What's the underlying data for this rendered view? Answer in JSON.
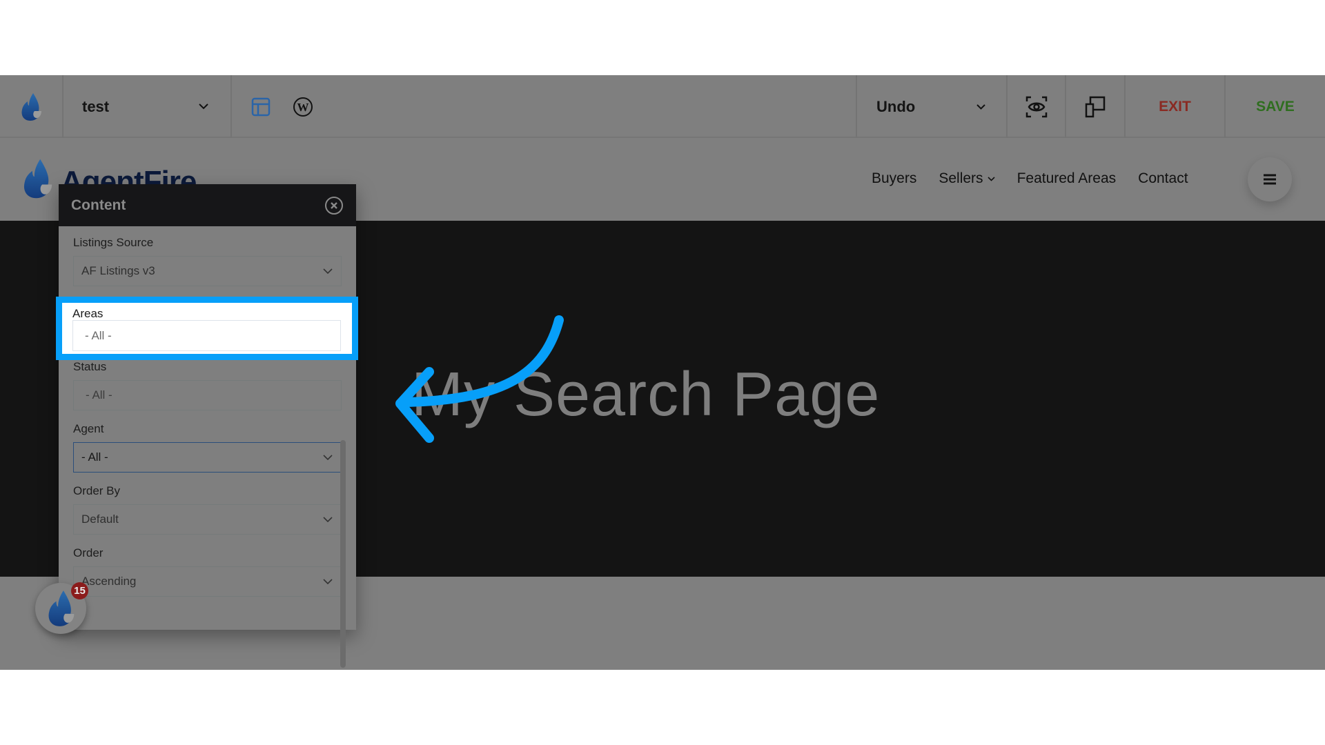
{
  "toolbar": {
    "page_selector": "test",
    "undo_label": "Undo",
    "exit_label": "EXIT",
    "save_label": "SAVE",
    "icons": {
      "logo": "flame-logo-icon",
      "layout": "layout-icon",
      "wordpress": "wordpress-icon",
      "preview": "eye-preview-icon",
      "responsive": "responsive-devices-icon"
    },
    "colors": {
      "exit": "#8a2a22",
      "save": "#2f6e1f",
      "layout_icon": "#2a64a8"
    }
  },
  "site_header": {
    "logo_text": "AgentFire",
    "nav": [
      {
        "label": "Buyers",
        "has_dropdown": false
      },
      {
        "label": "Sellers",
        "has_dropdown": true
      },
      {
        "label": "Featured Areas",
        "has_dropdown": false
      },
      {
        "label": "Contact",
        "has_dropdown": false
      }
    ]
  },
  "hero": {
    "title": "My Search Page"
  },
  "panel": {
    "title": "Content",
    "fields": [
      {
        "label": "Listings Source",
        "value": "AF Listings v3",
        "type": "select"
      },
      {
        "label": "Areas",
        "value": "- All -",
        "type": "input",
        "highlighted": true
      },
      {
        "label": "Status",
        "value": "- All -",
        "type": "input"
      },
      {
        "label": "Agent",
        "value": "- All -",
        "type": "select",
        "focused": true
      },
      {
        "label": "Order By",
        "value": "Default",
        "type": "select"
      },
      {
        "label": "Order",
        "value": "Ascending",
        "type": "select"
      }
    ]
  },
  "annotation": {
    "color": "#079ff9",
    "arrow": "curved-arrow-pointing-left"
  },
  "floating_button": {
    "badge_count": "15"
  }
}
